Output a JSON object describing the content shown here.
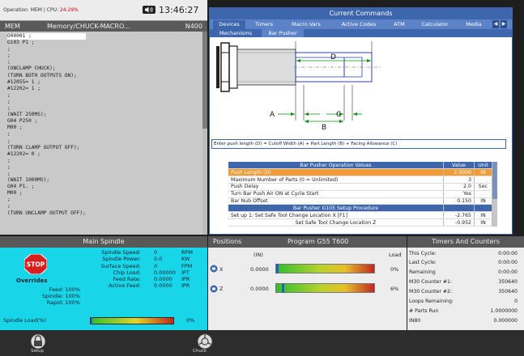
{
  "status_bar": {
    "operation": "Operation: MEM | CPU:",
    "cpu": "24.29%",
    "clock": "13:46:27",
    "audio_icon": "speaker-icon"
  },
  "program": {
    "mode": "MEM",
    "path": "Memory/CHUCK-MACRO...",
    "line": "N400",
    "code": [
      "O00001 ;",
      "G103 P1 ;",
      ";",
      ";",
      ";",
      "(UNCLAMP CHUCK);",
      "(TURN BOTH OUTPUTS ON);",
      "#12055= 1 ;",
      "#12202= 1 ;",
      ";",
      ";",
      ";",
      "(WAIT 250MS);",
      "G04 P250 ;",
      "M00 ;",
      ";",
      ";",
      "(TURN CLAMP OUTPUT OFF);",
      "#12202= 0 ;",
      ";",
      ";",
      ";",
      "(WAIT 1000MS);",
      "G04 P1. ;",
      "M00 ;",
      ";",
      ";",
      "(TURN UNCLAMP OUTPUT OFF);"
    ]
  },
  "current_commands": {
    "title": "Current Commands",
    "tabs": [
      "Devices",
      "Timers",
      "Macro Vars",
      "Active Codes",
      "ATM",
      "Calculator",
      "Media"
    ],
    "subtabs": [
      "Mechanisms",
      "Bar Pusher"
    ],
    "diagram_labels": {
      "d": "D",
      "a": "A",
      "c": "C",
      "b": "B"
    },
    "instruction": "Enter push length (D) = Cutoff Width (A) + Part Length (B) + Facing Allowance (C)",
    "table": {
      "headers": [
        "Bar Pusher Operation Values",
        "Value",
        "Unit"
      ],
      "rows": [
        {
          "label": "Push Length (D)",
          "value": "2.0000",
          "unit": "IN"
        },
        {
          "label": "Maximum Number of Parts (0 = Unlimited)",
          "value": "3",
          "unit": ""
        },
        {
          "label": "Push Delay",
          "value": "2.0",
          "unit": "Sec"
        },
        {
          "label": "Turn Bar Push Air ON at Cycle Start",
          "value": "Yes",
          "unit": ""
        },
        {
          "label": "Bar Nub Offset",
          "value": "0.150",
          "unit": "IN"
        }
      ],
      "procedure_header": "Bar Pusher G105 Setup Procedure",
      "procedure_rows": [
        {
          "label": "Set up 1: Set Safe Tool Change Location X [F1]",
          "value": "-2.765",
          "unit": "IN"
        },
        {
          "label": "Set Safe Tool Change Location Z",
          "value": "-0.952",
          "unit": "IN"
        }
      ]
    }
  },
  "main_spindle": {
    "title": "Main Spindle",
    "stop_label": "STOP",
    "overrides_title": "Overrides",
    "overrides": [
      {
        "label": "Feed:",
        "value": "100%"
      },
      {
        "label": "Spindle:",
        "value": "100%"
      },
      {
        "label": "Rapid:",
        "value": "100%"
      }
    ],
    "stats": [
      {
        "label": "Spindle Speed:",
        "value": "0",
        "unit": "RPM"
      },
      {
        "label": "Spindle Power:",
        "value": "0.0",
        "unit": "KW"
      },
      {
        "label": "Surface Speed:",
        "value": "0",
        "unit": "FPM"
      },
      {
        "label": "Chip Load:",
        "value": "0.00000",
        "unit": "IPT"
      },
      {
        "label": "Feed Rate:",
        "value": "0.0000",
        "unit": "IPR"
      },
      {
        "label": "Active Feed:",
        "value": "0.0000",
        "unit": "IPR"
      }
    ],
    "load_label": "Spindle Load(%)",
    "load_value": "0%",
    "load_fraction": 0.0
  },
  "positions": {
    "title": "Positions",
    "program": "Program G55 T600",
    "unit_label": "(IN)",
    "load_label": "Load",
    "axes": [
      {
        "name": "X",
        "value": "0.0000",
        "load": "0%",
        "load_fraction": 0.0
      },
      {
        "name": "Z",
        "value": "0.0000",
        "load": "6%",
        "load_fraction": 0.06
      }
    ]
  },
  "timers": {
    "title": "Timers And Counters",
    "rows": [
      {
        "label": "This Cycle:",
        "value": "0:00:00"
      },
      {
        "label": "Last Cycle:",
        "value": "0:00:00"
      },
      {
        "label": "Remaining",
        "value": "0:00:00"
      },
      {
        "label": "M30 Counter #1:",
        "value": "350640"
      },
      {
        "label": "M30 Counter #2:",
        "value": "350640"
      },
      {
        "label": "Loops Remaining:",
        "value": "0"
      },
      {
        "label": "# Parts Run",
        "value": "1.0000000"
      },
      {
        "label": "IN80",
        "value": "0.000000"
      }
    ]
  },
  "dock": {
    "setup_label": "Setup",
    "chuck_label": "Chuck",
    "setup_icon": "padlock-icon",
    "chuck_icon": "chuck-icon"
  },
  "colors": {
    "accent_blue": "#3e66ad",
    "selected_row": "#f29b34",
    "spindle_panel": "#18d5e8",
    "stop_red": "#d81f1f"
  }
}
